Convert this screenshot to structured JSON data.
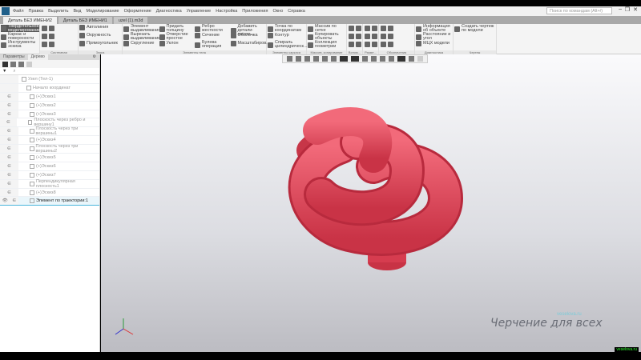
{
  "menu": [
    "Файл",
    "Правка",
    "Выделить",
    "Вид",
    "Моделирование",
    "Оформление",
    "Диагностика",
    "Управление",
    "Настройка",
    "Приложения",
    "Окно",
    "Справка"
  ],
  "search_placeholder": "Поиск по командам (Alt+/)",
  "tabs": [
    {
      "label": "Деталь БЕЗ ИМЕНИ2",
      "active": true
    },
    {
      "label": "Деталь БЕЗ ИМЕНИ1",
      "active": false
    },
    {
      "label": "uzel (1).m3d",
      "active": false
    }
  ],
  "ribbon": {
    "modes": [
      "Твердотельное моделирование",
      "Каркас и поверхности",
      "Инструменты эскиза"
    ],
    "groups": [
      {
        "label": "Системная",
        "items": []
      },
      {
        "label": "Эскиз",
        "items": [
          "Автолиния",
          "Окружность",
          "Прямоугольник"
        ]
      },
      {
        "label": "Элементы тела",
        "items": [
          "Элемент выдавливания",
          "Вырезать выдавливанием",
          "Скругление",
          "Придать толщину",
          "Отверстие простое",
          "Уклон",
          "Ребро жесткости",
          "Сечение",
          "Булева операция",
          "Добавить детали-загото...",
          "Оболочка",
          "Масштабиров..."
        ]
      },
      {
        "label": "Элементы каркаса",
        "items": [
          "Точка по координатам",
          "Контур",
          "Спираль цилиндрическ..."
        ]
      },
      {
        "label": "Массив, копирование",
        "items": [
          "Массив по сетке",
          "Копировать объекты",
          "Коллекция геометрии"
        ]
      },
      {
        "label": "Вспом...",
        "items": []
      },
      {
        "label": "Разме...",
        "items": []
      },
      {
        "label": "Обозначения",
        "items": []
      },
      {
        "label": "Диагностика",
        "items": [
          "Информация об объекте",
          "Расстояние и угол",
          "МЦХ модели"
        ]
      },
      {
        "label": "Чертеж",
        "items": [
          "Создать чертеж по модели"
        ]
      }
    ]
  },
  "panel": {
    "tabs": [
      "Параметры",
      "Дерево"
    ],
    "tree": [
      {
        "label": "Узел (Тел-1)",
        "type": "root"
      },
      {
        "label": "Начало координат",
        "type": "origin"
      },
      {
        "label": "(+)Эскиз1",
        "type": "sketch"
      },
      {
        "label": "(+)Эскиз2",
        "type": "sketch"
      },
      {
        "label": "(+)Эскиз3",
        "type": "sketch"
      },
      {
        "label": "Плоскость через ребро и вершину1",
        "type": "plane"
      },
      {
        "label": "Плоскость через три вершины1",
        "type": "plane"
      },
      {
        "label": "(+)Эскиз4",
        "type": "sketch"
      },
      {
        "label": "Плоскость через три вершины2",
        "type": "plane"
      },
      {
        "label": "(+)Эскиз5",
        "type": "sketch"
      },
      {
        "label": "(+)Эскиз6",
        "type": "sketch"
      },
      {
        "label": "(+)Эскиз7",
        "type": "sketch"
      },
      {
        "label": "Перпендикулярная плоскость1",
        "type": "plane"
      },
      {
        "label": "(+)Эскиз8",
        "type": "sketch"
      },
      {
        "label": "Элемент по траектории:1",
        "type": "feature",
        "selected": true
      }
    ]
  },
  "watermark": {
    "title": "Черчение для всех",
    "site": "veselova.ru"
  },
  "colors": {
    "model": "#e04a5c",
    "accent": "#4ab6dc"
  }
}
